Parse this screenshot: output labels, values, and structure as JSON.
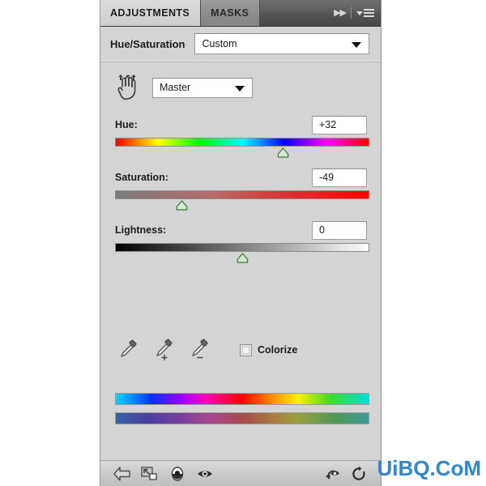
{
  "panel": {
    "tabs": [
      {
        "label": "ADJUSTMENTS",
        "active": true
      },
      {
        "label": "MASKS",
        "active": false
      }
    ],
    "expand_icon": "▶▶",
    "menu_icon": "panel-menu-icon",
    "adjustment_title": "Hue/Saturation",
    "preset": {
      "value": "Custom",
      "caret_icon": "chevron-down-icon"
    },
    "target_adjustment_icon": "scrubby-hand-icon",
    "channel": {
      "value": "Master",
      "caret_icon": "chevron-down-icon"
    },
    "sliders": [
      {
        "id": "hue",
        "label": "Hue:",
        "value": "+32",
        "position_pct": 66,
        "track": "hue-spectrum"
      },
      {
        "id": "saturation",
        "label": "Saturation:",
        "value": "-49",
        "position_pct": 26,
        "track": "saturation-gradient"
      },
      {
        "id": "lightness",
        "label": "Lightness:",
        "value": "0",
        "position_pct": 50,
        "track": "lightness-gradient"
      }
    ],
    "eyedroppers": [
      {
        "name": "eyedropper-icon",
        "title": "Sample"
      },
      {
        "name": "eyedropper-plus-icon",
        "title": "Add to Sample"
      },
      {
        "name": "eyedropper-minus-icon",
        "title": "Subtract from Sample"
      }
    ],
    "colorize": {
      "label": "Colorize",
      "checked": false
    },
    "spectrum_bars": {
      "top": "vivid-hue-spectrum",
      "bottom": "adjusted-hue-spectrum"
    },
    "footer_buttons": [
      {
        "name": "return-to-adjustment-list-button",
        "icon": "left-arrow-icon"
      },
      {
        "name": "clip-to-layer-button",
        "icon": "clip-to-layer-icon"
      },
      {
        "name": "toggle-layer-visibility-button",
        "icon": "mask-visibility-icon"
      },
      {
        "name": "preview-button",
        "icon": "eye-icon"
      },
      {
        "name": "reset-preview-button",
        "icon": "eye-arrow-icon"
      },
      {
        "name": "reset-adjustment-button",
        "icon": "reset-circular-arrow-icon"
      }
    ]
  },
  "watermark": {
    "text": "UiBQ.CoM",
    "color": "#2f86d4"
  },
  "colors": {
    "panel_bg": "#d4d4d4",
    "tab_bar_bg": "#5c5c5c",
    "active_tab_bg": "#d3d3d3",
    "thumb_fill": "#d6e8cf",
    "thumb_stroke": "#3f7a3f"
  }
}
